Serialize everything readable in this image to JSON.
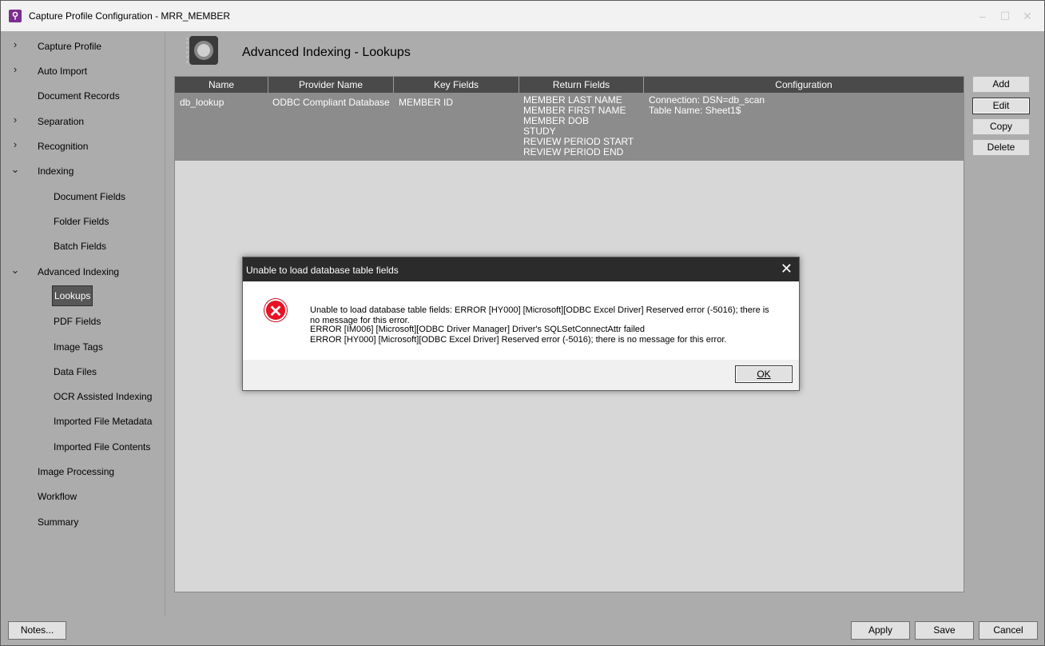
{
  "window": {
    "title": "Capture Profile Configuration - MRR_MEMBER",
    "app_icon_glyph": "⚲"
  },
  "sidebar": {
    "items": [
      {
        "label": "Capture Profile",
        "arrow": "›",
        "indent": 0
      },
      {
        "label": "Auto Import",
        "arrow": "›",
        "indent": 0
      },
      {
        "label": "Document Records",
        "arrow": "",
        "indent": 0
      },
      {
        "label": "Separation",
        "arrow": "›",
        "indent": 0
      },
      {
        "label": "Recognition",
        "arrow": "›",
        "indent": 0
      },
      {
        "label": "Indexing",
        "arrow": "⌄",
        "indent": 0
      },
      {
        "label": "Document Fields",
        "arrow": "",
        "indent": 1
      },
      {
        "label": "Folder Fields",
        "arrow": "",
        "indent": 1
      },
      {
        "label": "Batch Fields",
        "arrow": "",
        "indent": 1
      },
      {
        "label": "Advanced Indexing",
        "arrow": "⌄",
        "indent": 0
      },
      {
        "label": "Lookups",
        "arrow": "",
        "indent": 1,
        "selected": true
      },
      {
        "label": "PDF Fields",
        "arrow": "",
        "indent": 1
      },
      {
        "label": "Image Tags",
        "arrow": "",
        "indent": 1
      },
      {
        "label": "Data Files",
        "arrow": "",
        "indent": 1
      },
      {
        "label": "OCR Assisted Indexing",
        "arrow": "",
        "indent": 1
      },
      {
        "label": "Imported File Metadata",
        "arrow": "",
        "indent": 1
      },
      {
        "label": "Imported File Contents",
        "arrow": "",
        "indent": 1
      },
      {
        "label": "Image Processing",
        "arrow": "",
        "indent": 0
      },
      {
        "label": "Workflow",
        "arrow": "",
        "indent": 0
      },
      {
        "label": "Summary",
        "arrow": "",
        "indent": 0
      }
    ]
  },
  "header": {
    "title": "Advanced Indexing - Lookups"
  },
  "grid": {
    "columns": [
      "Name",
      "Provider Name",
      "Key Fields",
      "Return Fields",
      "Configuration"
    ],
    "rows": [
      {
        "name": "db_lookup",
        "provider": "ODBC Compliant Database",
        "key_fields": "MEMBER ID",
        "return_fields": [
          "MEMBER LAST NAME",
          "MEMBER FIRST NAME",
          "MEMBER DOB",
          "STUDY",
          "REVIEW PERIOD START",
          "REVIEW PERIOD END"
        ],
        "configuration": [
          "Connection: DSN=db_scan",
          "Table Name: Sheet1$"
        ]
      }
    ]
  },
  "side_buttons": {
    "add": "Add",
    "edit": "Edit",
    "copy": "Copy",
    "delete": "Delete"
  },
  "footer": {
    "notes": "Notes...",
    "apply": "Apply",
    "save": "Save",
    "cancel": "Cancel"
  },
  "dialog": {
    "title": "Unable to load database table fields",
    "close_glyph": "✕",
    "icon_glyph": "✕",
    "message_lines": [
      "Unable to load database table fields: ERROR [HY000] [Microsoft][ODBC Excel Driver] Reserved error (-5016); there is",
      "no message for this error.",
      "ERROR [IM006] [Microsoft][ODBC Driver Manager] Driver's SQLSetConnectAttr failed",
      "ERROR [HY000] [Microsoft][ODBC Excel Driver] Reserved error (-5016); there is no message for this error."
    ],
    "ok": "OK"
  },
  "colors": {
    "accent_icon": "#7b2e8e",
    "error_red": "#e81123",
    "grid_header": "#4a4a4a",
    "selected_row": "#8c8c8c"
  }
}
